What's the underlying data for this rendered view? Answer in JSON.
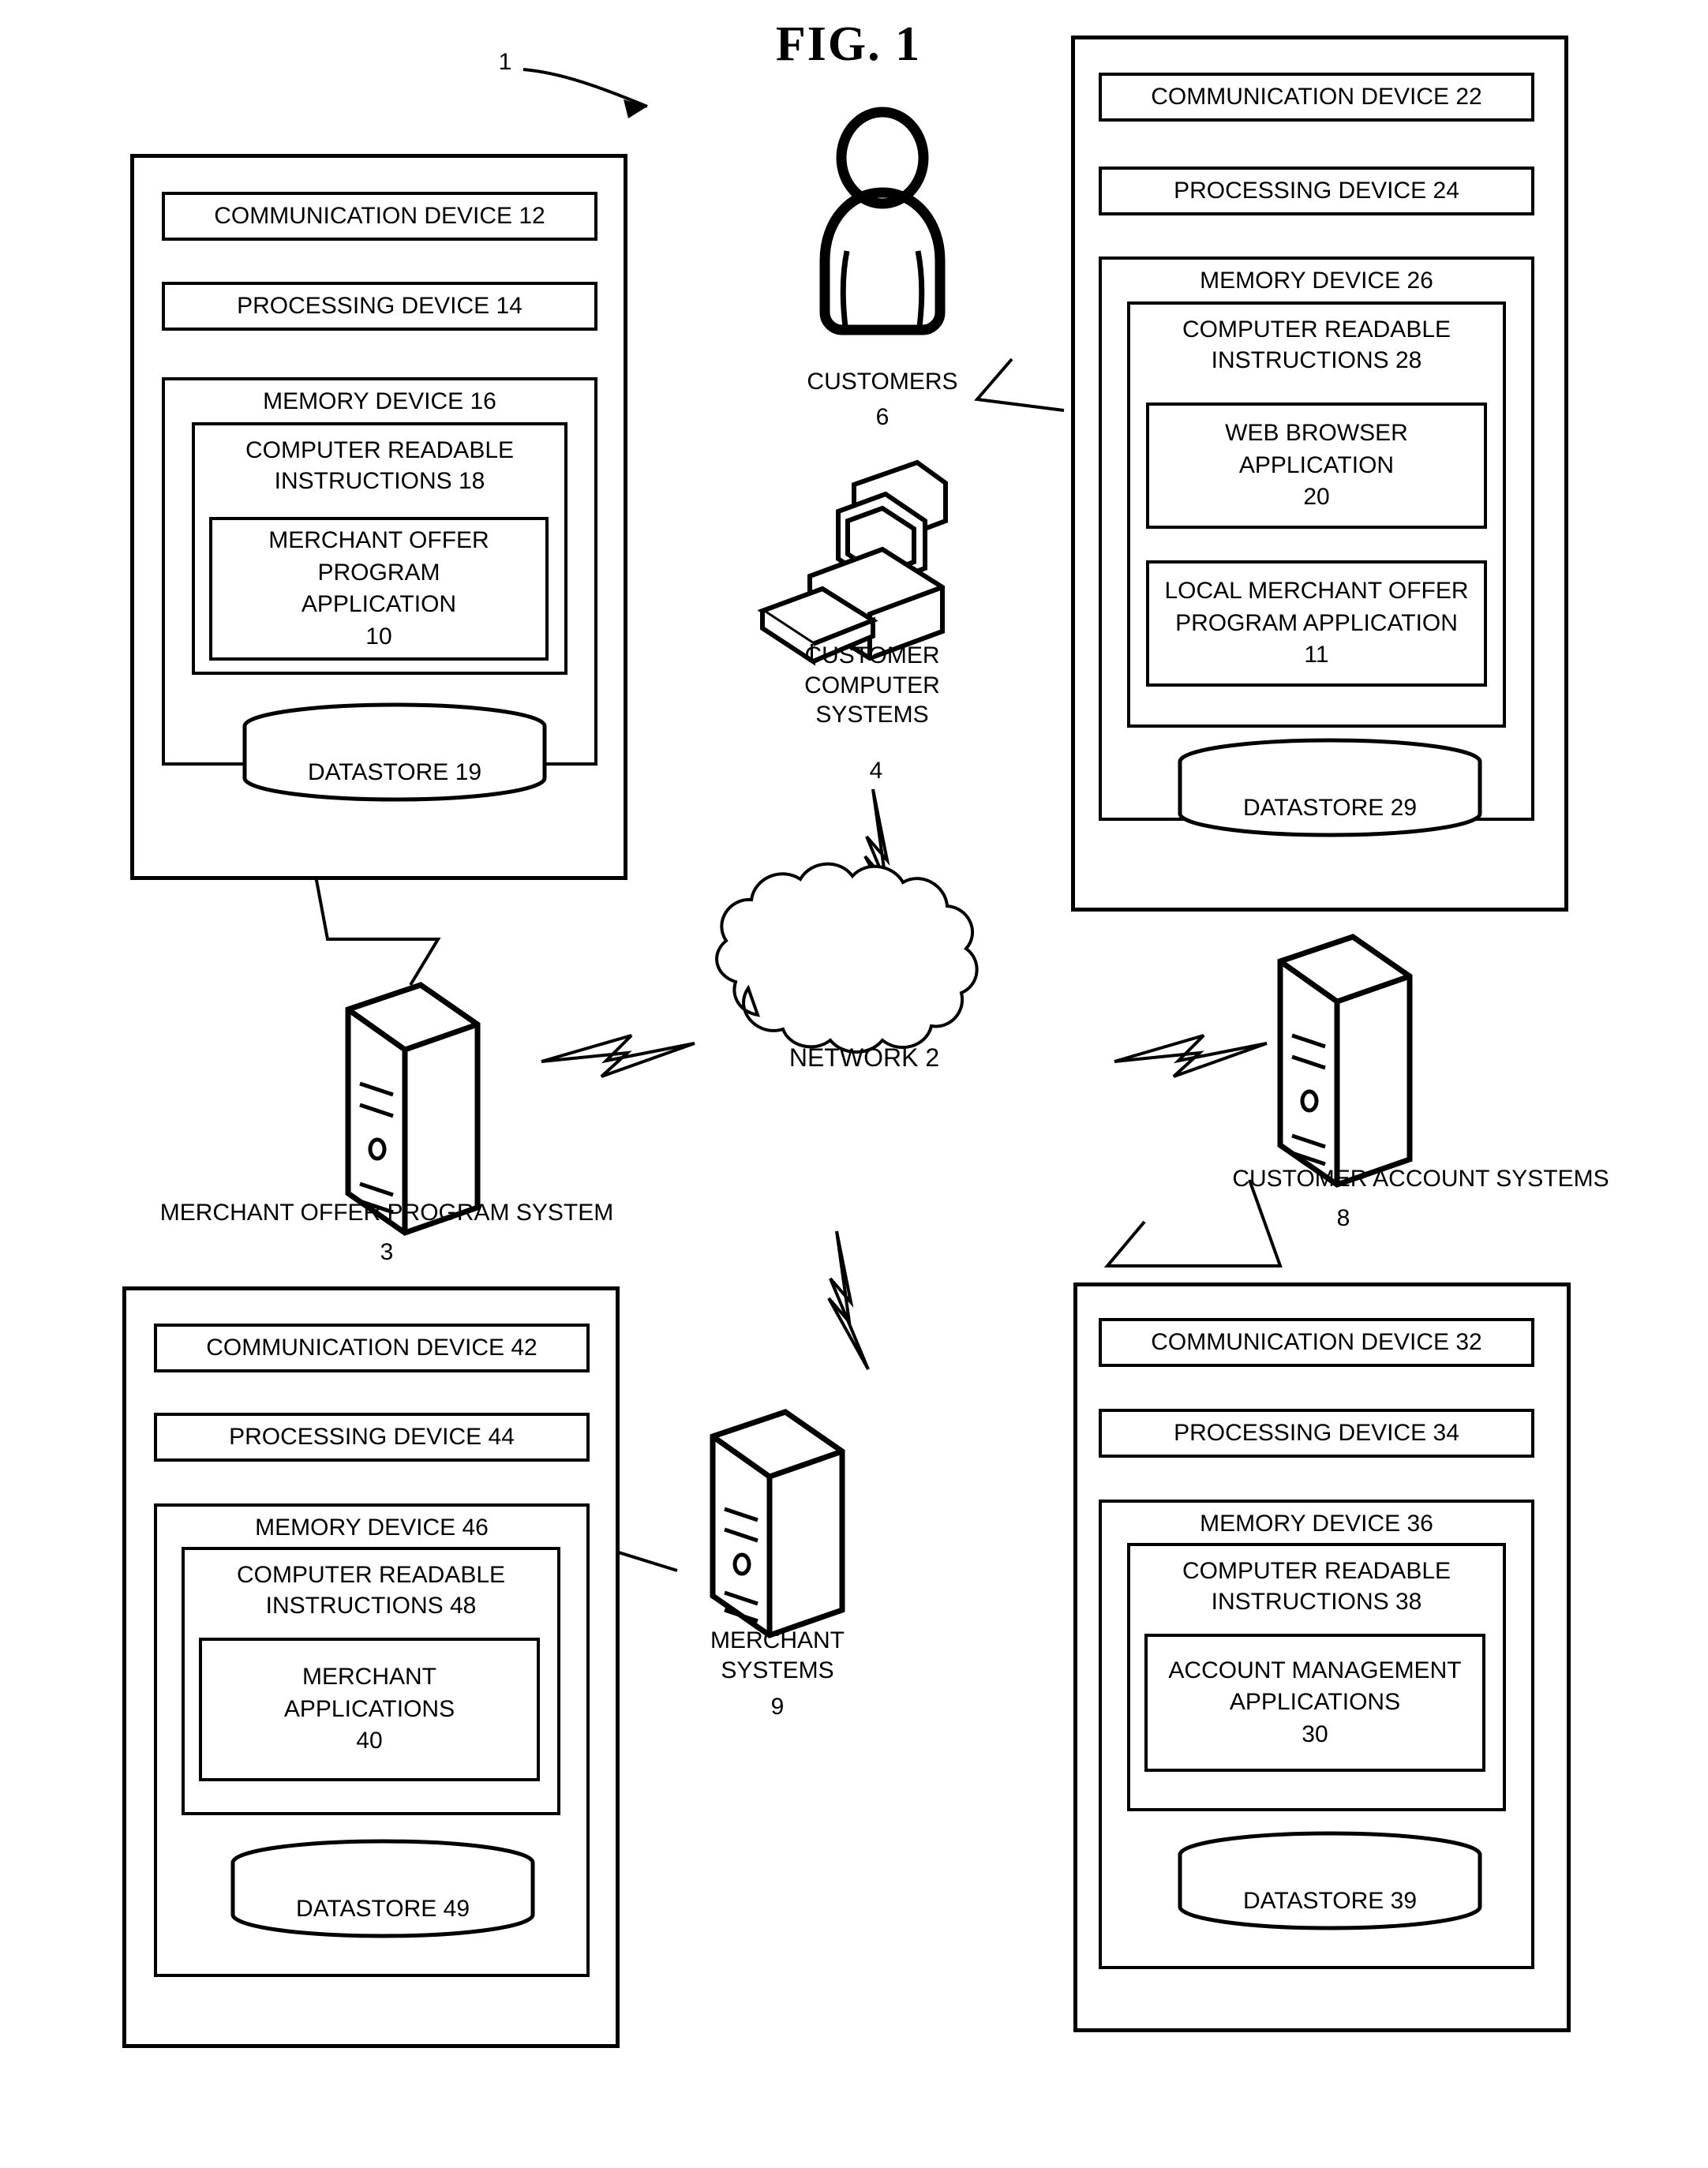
{
  "figure": {
    "title": "FIG. 1",
    "system_ref": "1",
    "network_label": "NETWORK 2"
  },
  "merchant_offer_program_system": {
    "communication_device": "COMMUNICATION DEVICE 12",
    "processing_device": "PROCESSING DEVICE 14",
    "memory_device": "MEMORY DEVICE 16",
    "computer_readable_instructions": "COMPUTER READABLE\nINSTRUCTIONS 18",
    "application": "MERCHANT OFFER\nPROGRAM\nAPPLICATION\n10",
    "datastore": "DATASTORE 19",
    "system_label": "MERCHANT OFFER PROGRAM SYSTEM",
    "system_ref": "3"
  },
  "customer_computer_systems_panel": {
    "communication_device": "COMMUNICATION DEVICE 22",
    "processing_device": "PROCESSING DEVICE 24",
    "memory_device": "MEMORY DEVICE 26",
    "computer_readable_instructions": "COMPUTER READABLE\nINSTRUCTIONS 28",
    "web_browser_application": "WEB BROWSER\nAPPLICATION\n20",
    "local_merchant_offer_application": "LOCAL MERCHANT OFFER\nPROGRAM APPLICATION\n11",
    "datastore": "DATASTORE 29"
  },
  "merchant_systems_panel": {
    "communication_device": "COMMUNICATION DEVICE 42",
    "processing_device": "PROCESSING DEVICE 44",
    "memory_device": "MEMORY DEVICE 46",
    "computer_readable_instructions": "COMPUTER READABLE\nINSTRUCTIONS 48",
    "application": "MERCHANT\nAPPLICATIONS\n40",
    "datastore": "DATASTORE 49",
    "system_label": "MERCHANT\nSYSTEMS",
    "system_ref": "9"
  },
  "customer_account_systems_panel": {
    "communication_device": "COMMUNICATION DEVICE 32",
    "processing_device": "PROCESSING DEVICE 34",
    "memory_device": "MEMORY DEVICE 36",
    "computer_readable_instructions": "COMPUTER READABLE\nINSTRUCTIONS 38",
    "application": "ACCOUNT MANAGEMENT\nAPPLICATIONS\n30",
    "datastore": "DATASTORE 39",
    "system_label": "CUSTOMER ACCOUNT SYSTEMS",
    "system_ref": "8"
  },
  "actors": {
    "customers_label": "CUSTOMERS",
    "customers_ref": "6",
    "customer_computer_systems_label": "CUSTOMER\nCOMPUTER\nSYSTEMS",
    "customer_computer_systems_ref": "4"
  }
}
